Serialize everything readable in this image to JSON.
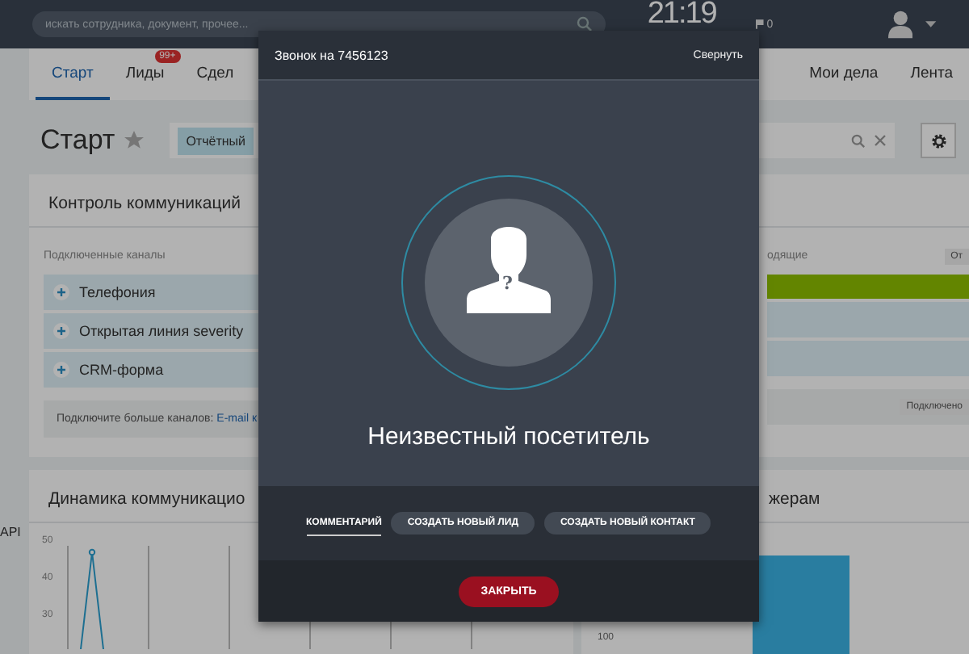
{
  "top_bar": {
    "search_placeholder": "искать сотрудника, документ, прочее...",
    "clock": "21:19",
    "flag_count": "0"
  },
  "nav_tabs": [
    {
      "label": "Старт",
      "selected": true
    },
    {
      "label": "Лиды",
      "selected": false,
      "badge": "99+"
    },
    {
      "label": "Сдел",
      "selected": false
    },
    {
      "label": "Мои дела",
      "selected": false
    },
    {
      "label": "Лента",
      "selected": false
    }
  ],
  "page_title": "Старт",
  "filter": {
    "chip": "Отчётный"
  },
  "control_panel": {
    "title": "Контроль коммуникаций",
    "subtitle": "Подключенные каналы",
    "right_subtitle": "одящие",
    "right_button": "От",
    "channels": [
      "Телефония",
      "Открытая линия severity",
      "CRM-форма"
    ],
    "more_text": "Подключите больше каналов:",
    "more_link": "E-mail к",
    "progress": {
      "level": 1
    },
    "connected_button": "Подключено"
  },
  "dynamics_panel": {
    "title": "Динамика коммуникацио",
    "side_label": "API",
    "y_ticks": [
      "50",
      "40",
      "30"
    ]
  },
  "managers_panel": {
    "title": "жерам",
    "y_tick": "100"
  },
  "call_dialog": {
    "title": "Звонок на 7456123",
    "collapse": "Свернуть",
    "avatar_mark": "?",
    "caller": "Неизвестный посетитель",
    "actions": [
      {
        "label": "КОММЕНТАРИЙ",
        "selected": true
      },
      {
        "label": "СОЗДАТЬ НОВЫЙ ЛИД",
        "selected": false
      },
      {
        "label": "СОЗДАТЬ НОВЫЙ КОНТАКТ",
        "selected": false
      }
    ],
    "close": "ЗАКРЫТЬ"
  }
}
